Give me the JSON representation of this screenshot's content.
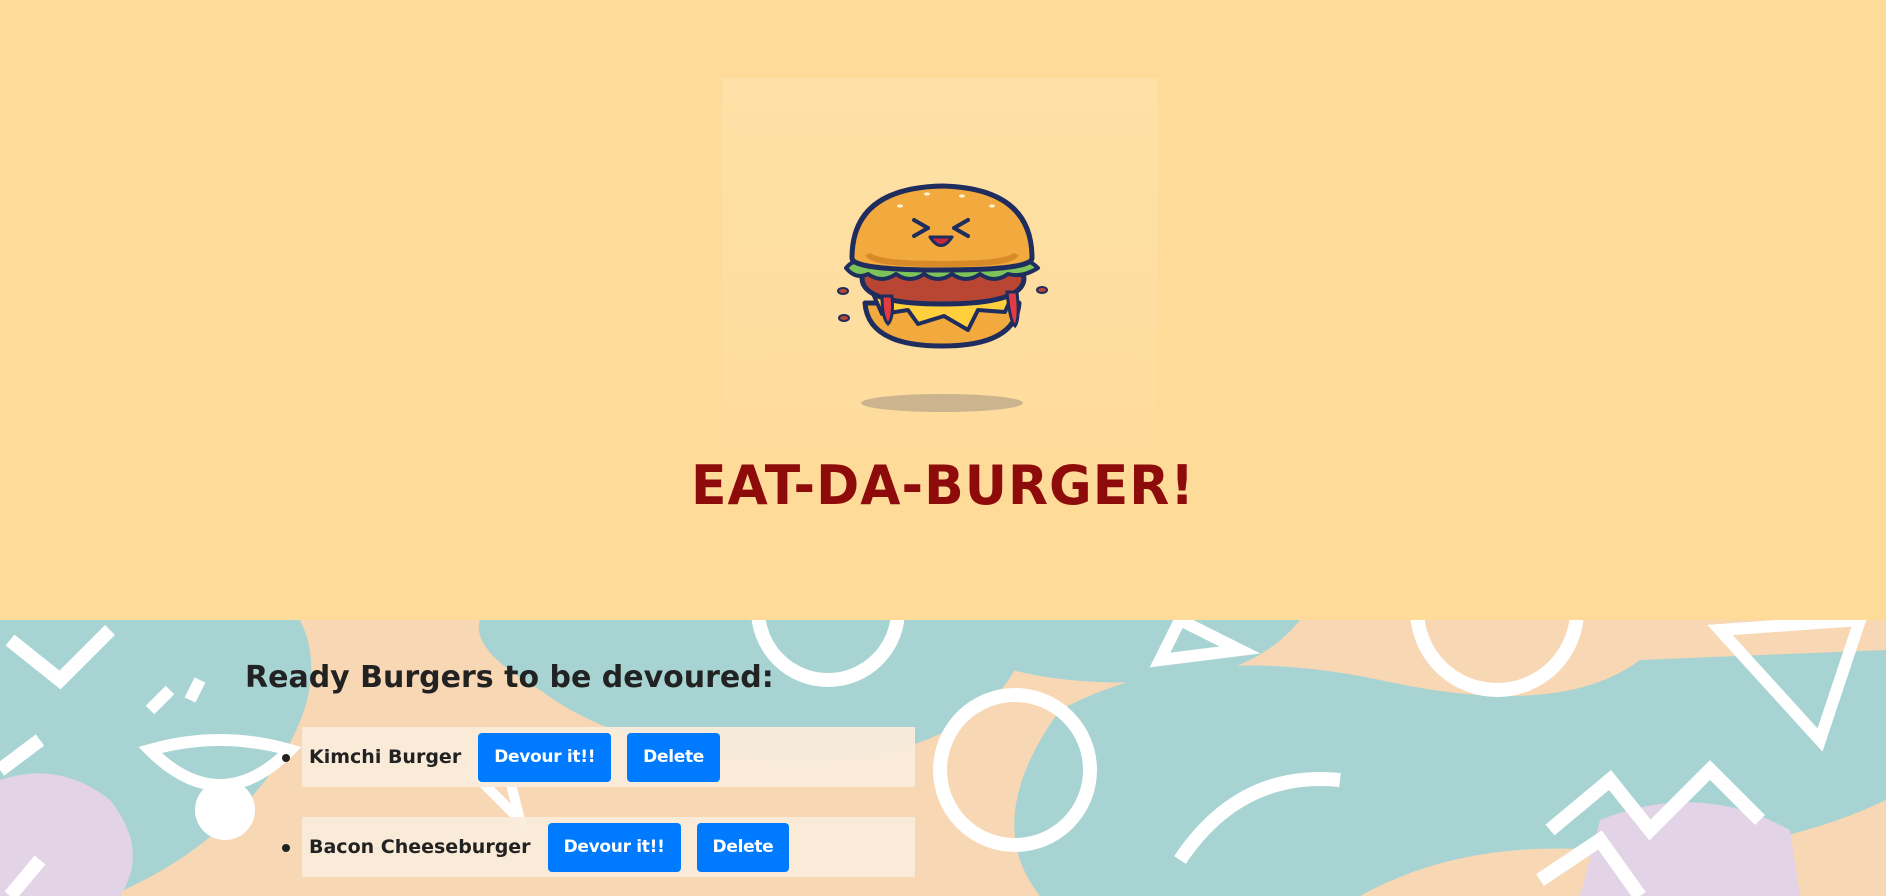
{
  "header": {
    "title": "EAT-DA-BURGER!",
    "logo_icon": "burger-mascot-icon"
  },
  "main": {
    "heading": "Ready Burgers to be devoured:",
    "burgers": [
      {
        "name": "Kimchi Burger",
        "devour_label": "Devour it!!",
        "delete_label": "Delete"
      },
      {
        "name": "Bacon Cheeseburger",
        "devour_label": "Devour it!!",
        "delete_label": "Delete"
      }
    ]
  },
  "colors": {
    "hero_bg": "#fedb98",
    "title": "#8e0b0b",
    "button": "#007bff",
    "pattern_teal": "#a7d3d3",
    "pattern_peach": "#f8d7b4",
    "pattern_lavender": "#e2d3e6"
  }
}
